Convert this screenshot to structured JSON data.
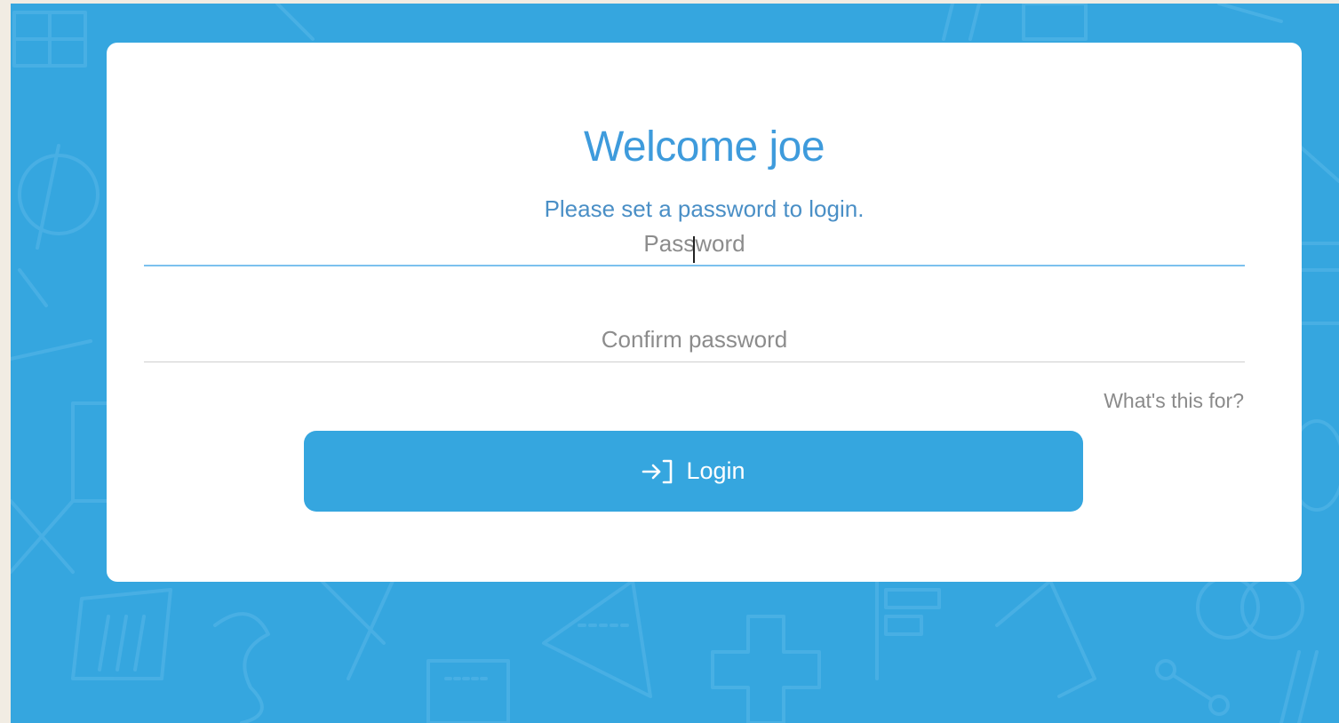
{
  "header": {
    "title": "Welcome joe",
    "subtitle": "Please set a password to login."
  },
  "form": {
    "password": {
      "value": "",
      "placeholder": "Password",
      "focused": true
    },
    "confirm_password": {
      "value": "",
      "placeholder": "Confirm password"
    },
    "help_link": "What's this for?",
    "login_button": {
      "label": "Login",
      "icon": "login-arrow-icon"
    }
  },
  "colors": {
    "background": "#35a6df",
    "card": "#ffffff",
    "accent": "#3e9bdc",
    "button": "#35a6df"
  }
}
